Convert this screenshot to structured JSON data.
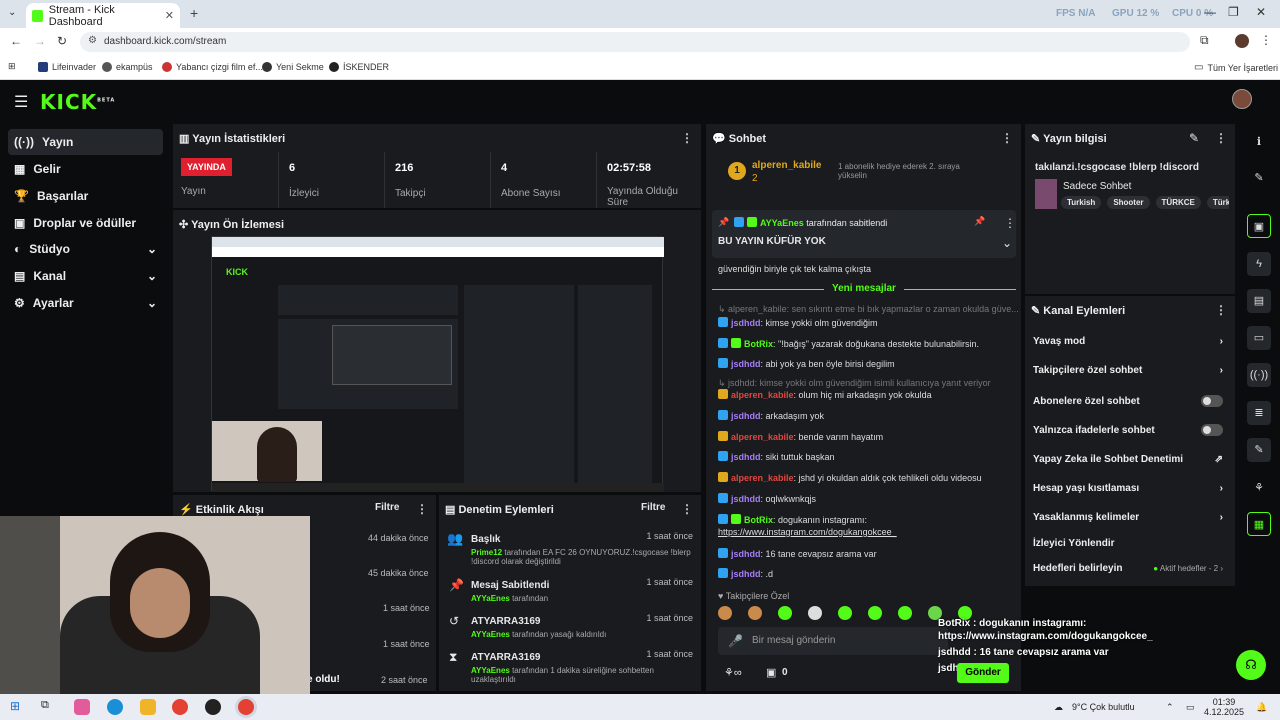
{
  "browser": {
    "tab_title": "Stream - Kick Dashboard",
    "url": "dashboard.kick.com/stream",
    "perf": {
      "fps": "FPS N/A",
      "gpu": "GPU 12 %",
      "cpu": "CPU 0 %"
    },
    "bookmarks": [
      "Lifeinvader",
      "ekampüs",
      "Yabancı çizgi film ef...",
      "Yeni Sekme",
      "İSKENDER"
    ],
    "bookmarks_right": "Tüm Yer İşaretleri"
  },
  "brand": {
    "logo": "KICK",
    "beta": "BETA"
  },
  "sidebar": {
    "items": [
      {
        "label": "Yayın"
      },
      {
        "label": "Gelir"
      },
      {
        "label": "Başarılar"
      },
      {
        "label": "Droplar ve ödüller"
      },
      {
        "label": "Stüdyo"
      },
      {
        "label": "Kanal"
      },
      {
        "label": "Ayarlar"
      }
    ]
  },
  "stats": {
    "title": "Yayın İstatistikleri",
    "live": "YAYINDA",
    "live_label": "Yayın",
    "viewers": "6",
    "viewers_label": "İzleyici",
    "followers": "216",
    "followers_label": "Takipçi",
    "subs": "4",
    "subs_label": "Abone Sayısı",
    "duration": "02:57:58",
    "duration_label": "Yayında Olduğu Süre"
  },
  "preview": {
    "title": "Yayın Ön İzlemesi"
  },
  "activity": {
    "title": "Etkinlik Akışı",
    "filter": "Filtre",
    "times": [
      "44 dakika önce",
      "45 dakika önce",
      "1 saat önce",
      "1 saat önce",
      "2 saat önce"
    ],
    "last": "e oldu!"
  },
  "moderation": {
    "title": "Denetim Eylemleri",
    "filter": "Filtre",
    "items": [
      {
        "title": "Başlık",
        "time": "1 saat önce",
        "user": "Prime12",
        "text": " tarafından EA FC 26 OYNUYORUZ.!csgocase !blerp !discord olarak değiştirildi"
      },
      {
        "title": "Mesaj Sabitlendi",
        "time": "1 saat önce",
        "user": "AYYaEnes",
        "text": " tarafından"
      },
      {
        "title": "ATYARRA3169",
        "time": "1 saat önce",
        "user": "AYYaEnes",
        "text": " tarafından yasağı kaldırıldı"
      },
      {
        "title": "ATYARRA3169",
        "time": "1 saat önce",
        "user": "AYYaEnes",
        "text": " tarafından 1 dakika süreliğine sohbetten uzaklaştırıldı"
      }
    ]
  },
  "chat": {
    "title": "Sohbet",
    "top_user": "alperen_kabile",
    "top_count": "2",
    "top_note": "1 abonelik hediye ederek 2. sıraya yükselin",
    "pinned_by": "AYYaEnes",
    "pinned_suffix": " tarafından sabitlendi",
    "pinned_text": "BU YAYIN KÜFÜR YOK",
    "pre_line": "güvendiğin biriyle çık tek kalma çıkışta",
    "new_messages": "Yeni mesajlar",
    "messages": [
      {
        "user": "",
        "text": "↳ alperen_kabile: sen sıkıntı etme bi bık yapmazlar o zaman okulda güve..."
      },
      {
        "user": "jsdhdd",
        "text": ": kimse yokki olm güvendiğim"
      },
      {
        "user": "BotRix",
        "text": ": \"!bağış\" yazarak doğukana destekte bulunabilirsin."
      },
      {
        "user": "jsdhdd",
        "text": ": abi yok ya ben öyle birisi degilim"
      },
      {
        "user": "",
        "text": "↳ jsdhdd: kimse yokki olm güvendiğim isimli kullanıcıya yanıt veriyor"
      },
      {
        "user": "alperen_kabile",
        "text": ": olum hiç mi arkadaşın yok okulda"
      },
      {
        "user": "jsdhdd",
        "text": ": arkadaşım yok"
      },
      {
        "user": "alperen_kabile",
        "text": ": bende varım hayatım"
      },
      {
        "user": "jsdhdd",
        "text": ": siki tuttuk başkan"
      },
      {
        "user": "alperen_kabile",
        "text": ": jshd yi okuldan aldık çok tehlikeli oldu videosu"
      },
      {
        "user": "jsdhdd",
        "text": ": oqlwkwnkqjs"
      },
      {
        "user": "BotRix",
        "text": ": dogukanın instagramı:"
      },
      {
        "user": "",
        "text": "https://www.instagram.com/dogukangokcee_"
      },
      {
        "user": "jsdhdd",
        "text": ": 16 tane cevapsız arama var"
      },
      {
        "user": "jsdhdd",
        "text": ": .d"
      }
    ],
    "followers_only": "Takipçilere Özel",
    "input_placeholder": "Bir mesaj gönderin",
    "points": "0",
    "send": "Gönder"
  },
  "overlay": {
    "line1": "BotRix : dogukanın instagramı:",
    "line2": "https://www.instagram.com/dogukangokcee_",
    "line3": "jsdhdd : 16 tane cevapsız arama var",
    "line4": "jsdhdd : .d"
  },
  "info": {
    "title": "Yayın bilgisi",
    "stream_title": "takılanzi.!csgocase !blerp !discord",
    "category": "Sadece Sohbet",
    "tags": [
      "Turkish",
      "Shooter",
      "TÜRKCE",
      "Türk"
    ]
  },
  "actions": {
    "title": "Kanal Eylemleri",
    "items": [
      {
        "label": "Yavaş mod",
        "kind": "arrow"
      },
      {
        "label": "Takipçilere özel sohbet",
        "kind": "arrow"
      },
      {
        "label": "Abonelere özel sohbet",
        "kind": "toggle"
      },
      {
        "label": "Yalnızca ifadelerle sohbet",
        "kind": "toggle"
      },
      {
        "label": "Yapay Zeka ile Sohbet Denetimi",
        "kind": "ext"
      },
      {
        "label": "Hesap yaşı kısıtlaması",
        "kind": "arrow"
      },
      {
        "label": "Yasaklanmış kelimeler",
        "kind": "arrow"
      },
      {
        "label": "İzleyici Yönlendir",
        "kind": "none"
      },
      {
        "label": "Hedefleri belirleyin",
        "kind": "arrow"
      }
    ],
    "goals_badge": "Aktif hedefler - 2"
  },
  "taskbar": {
    "weather": "9°C  Çok bulutlu",
    "time": "01:39",
    "date": "4.12.2025"
  },
  "colors": {
    "accent": "#53fc18",
    "live": "#e0202e",
    "panel": "#191b1f",
    "bg": "#0b0c0d"
  }
}
